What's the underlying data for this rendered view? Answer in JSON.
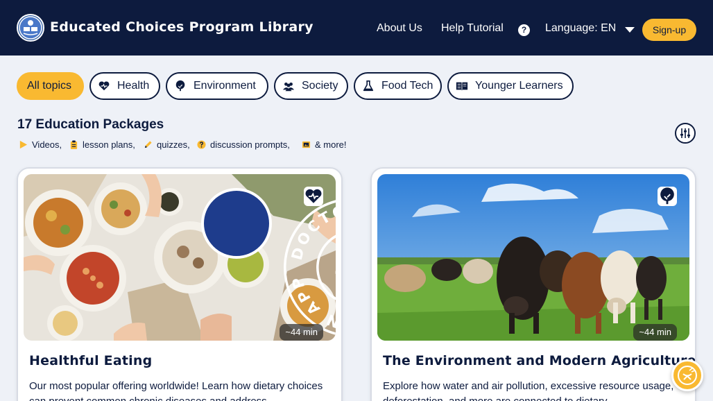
{
  "header": {
    "title": "Educated Choices Program Library",
    "about": "About Us",
    "help": "Help Tutorial",
    "help_icon": "?",
    "language": "Language: EN",
    "signup": "Sign-up"
  },
  "topics": [
    {
      "label": "All topics",
      "icon": "none",
      "active": true
    },
    {
      "label": "Health",
      "icon": "heart-icon"
    },
    {
      "label": "Environment",
      "icon": "tree-icon"
    },
    {
      "label": "Society",
      "icon": "people-icon"
    },
    {
      "label": "Food Tech",
      "icon": "flask-icon"
    },
    {
      "label": "Younger Learners",
      "icon": "book-icon"
    }
  ],
  "packages": {
    "heading": "17 Education Packages",
    "features": [
      "Videos,",
      "lesson plans,",
      "quizzes,",
      "discussion prompts,",
      "& more!"
    ]
  },
  "cards": [
    {
      "title": "Healthful Eating",
      "duration": "~44 min",
      "topic_icon": "heart-icon",
      "badge": "DOCTORS FOR NUTRITION APPROVED",
      "description": "Our most popular offering worldwide! Learn how dietary choices can prevent common chronic diseases and address"
    },
    {
      "title": "The Environment and Modern Agriculture",
      "duration": "~44 min",
      "topic_icon": "tree-icon",
      "description": "Explore how water and air pollution, excessive resource usage, deforestation, and more are connected to dietary"
    }
  ],
  "colors": {
    "navy": "#0d1b3e",
    "accent": "#f9b931",
    "background": "#eef1f7"
  }
}
